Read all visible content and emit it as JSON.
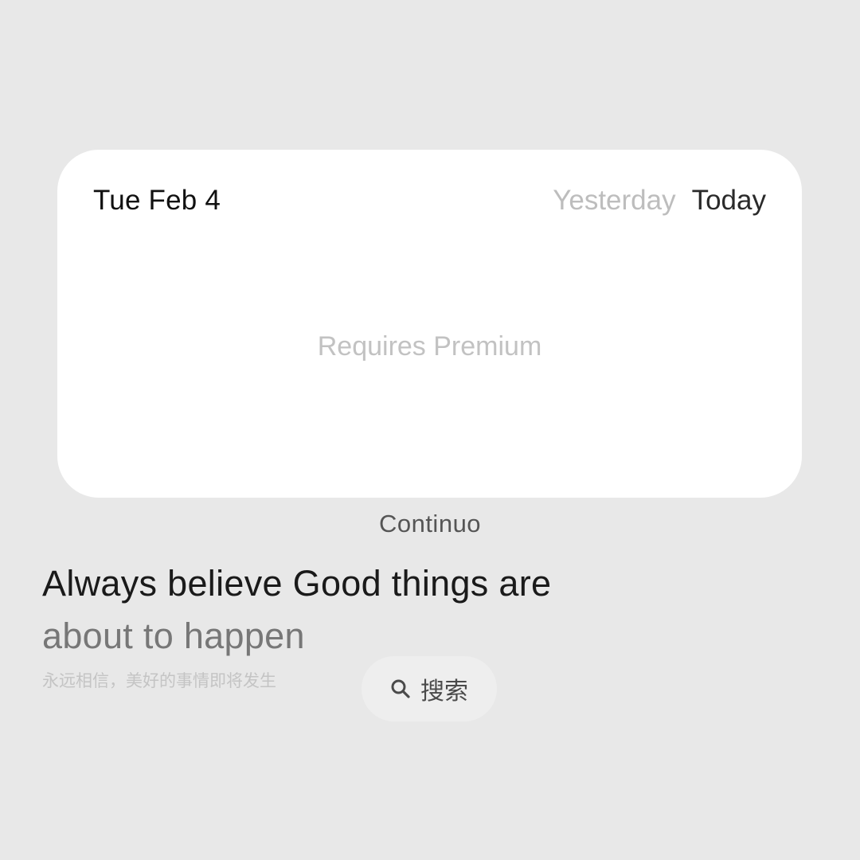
{
  "widget": {
    "date": "Tue Feb 4",
    "tabs": [
      {
        "label": "Yesterday",
        "active": false
      },
      {
        "label": "Today",
        "active": true
      }
    ],
    "message": "Requires Premium",
    "caption": "Continuo"
  },
  "quote": {
    "line1": "Always believe Good things are",
    "line2": "about to happen",
    "translation": "永远相信，美好的事情即将发生"
  },
  "search": {
    "label": "搜索",
    "icon": "search-icon"
  },
  "colors": {
    "background": "#e8e8e8",
    "card": "#ffffff",
    "inactive_tab": "#bdbdbd",
    "active_tab": "#2a2a2a"
  }
}
